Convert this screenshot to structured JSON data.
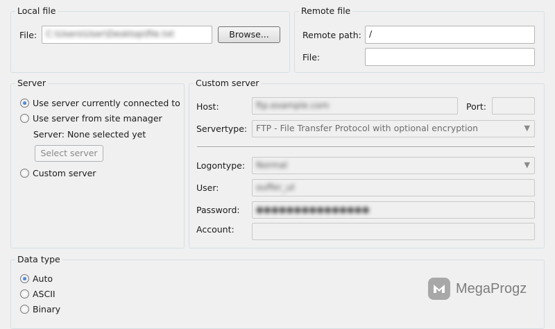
{
  "local_file": {
    "title": "Local file",
    "file_label": "File:",
    "file_value": "C:\\Users\\User\\Desktop\\file.txt",
    "browse_label": "Browse..."
  },
  "remote_file": {
    "title": "Remote file",
    "path_label": "Remote path:",
    "path_value": "/",
    "file_label": "File:",
    "file_value": ""
  },
  "server": {
    "title": "Server",
    "options": [
      {
        "label": "Use server currently connected to",
        "selected": true
      },
      {
        "label": "Use server from site manager",
        "selected": false
      },
      {
        "label": "Custom server",
        "selected": false
      }
    ],
    "server_status": "Server:  None selected yet",
    "select_server_label": "Select server"
  },
  "custom_server": {
    "title": "Custom server",
    "host_label": "Host:",
    "host_value": "ftp.example.com",
    "port_label": "Port:",
    "port_value": "",
    "servertype_label": "Servertype:",
    "servertype_value": "FTP - File Transfer Protocol with optional encryption",
    "logontype_label": "Logontype:",
    "logontype_value": "Normal",
    "user_label": "User:",
    "user_value": "ouffer_ut",
    "password_label": "Password:",
    "password_value": "●●●●●●●●●●●●●●●",
    "account_label": "Account:",
    "account_value": ""
  },
  "data_type": {
    "title": "Data type",
    "options": [
      {
        "label": "Auto",
        "selected": true
      },
      {
        "label": "ASCII",
        "selected": false
      },
      {
        "label": "Binary",
        "selected": false
      }
    ]
  },
  "watermark": {
    "text": "MegaProgz",
    "icon": "megaprogz-logo-icon"
  }
}
